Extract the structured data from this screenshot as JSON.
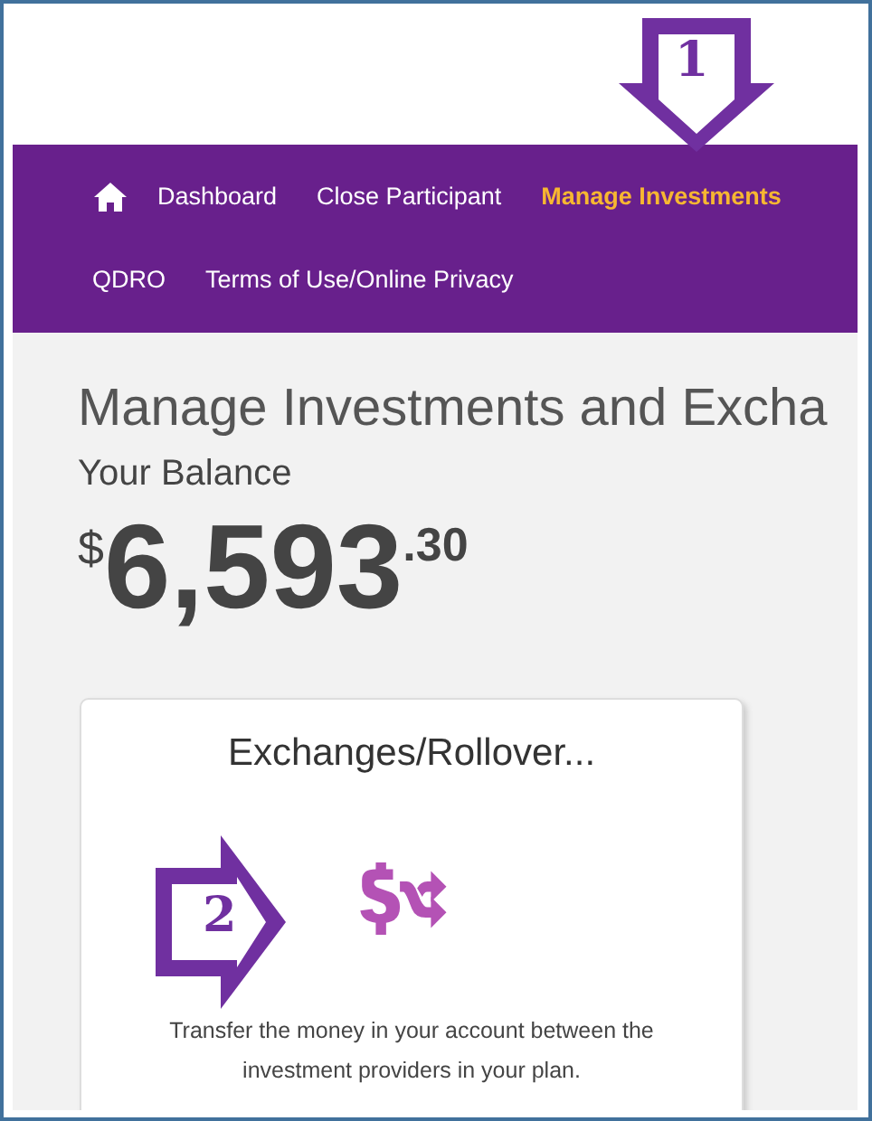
{
  "nav": {
    "items": [
      {
        "kind": "home",
        "selected": false
      },
      {
        "kind": "link",
        "label": "Dashboard",
        "selected": false
      },
      {
        "kind": "link",
        "label": "Close Participant",
        "selected": false
      },
      {
        "kind": "link",
        "label": "Manage Investments",
        "selected": true
      },
      {
        "kind": "link",
        "label": "QDRO",
        "selected": false
      },
      {
        "kind": "link",
        "label": "Terms of Use/Online Privacy",
        "selected": false
      }
    ]
  },
  "page": {
    "title": "Manage Investments and Excha",
    "balance_label": "Your Balance",
    "balance": {
      "currency": "$",
      "whole": "6,593",
      "cents": ".30"
    }
  },
  "card": {
    "title": "Exchanges/Rollover...",
    "description": "Transfer the money in your account between the investment providers in your plan."
  },
  "annotations": [
    {
      "kind": "down",
      "label": "1"
    },
    {
      "kind": "right",
      "label": "2"
    }
  ]
}
